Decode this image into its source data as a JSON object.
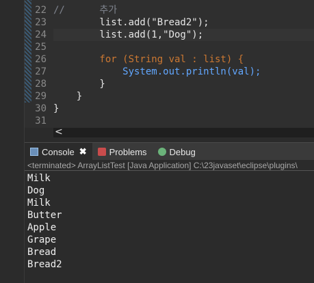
{
  "editor": {
    "lines": [
      {
        "num": "22",
        "code": "//      추가"
      },
      {
        "num": "23",
        "code": "        list.add(\"Bread2\");"
      },
      {
        "num": "24",
        "code": "        list.add(1,\"Dog\");"
      },
      {
        "num": "25",
        "code": ""
      },
      {
        "num": "26",
        "code": "        for (String val : list) {"
      },
      {
        "num": "27",
        "code": "            System.out.println(val);"
      },
      {
        "num": "28",
        "code": "        }"
      },
      {
        "num": "29",
        "code": "    }"
      },
      {
        "num": "30",
        "code": "}"
      },
      {
        "num": "31",
        "code": ""
      }
    ]
  },
  "hscroll": {
    "arrow": "<"
  },
  "tabs": {
    "console": "Console",
    "close": "✖",
    "problems": "Problems",
    "debug": "Debug"
  },
  "status": {
    "text": "<terminated> ArrayListTest [Java Application] C:\\23javaset\\eclipse\\plugins\\"
  },
  "console": {
    "output": [
      "Milk",
      "Dog",
      "Milk",
      "Butter",
      "Apple",
      "Grape",
      "Bread",
      "Bread2"
    ]
  }
}
